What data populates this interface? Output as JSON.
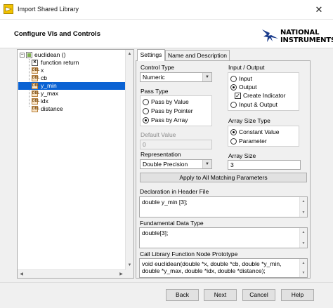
{
  "window": {
    "title": "Import Shared Library",
    "close_glyph": "✕"
  },
  "header": {
    "title": "Configure VIs and Controls",
    "logo_line1": "NATIONAL",
    "logo_line2": "INSTRUMENTS"
  },
  "tree": {
    "root": "euclidean ()",
    "items": [
      {
        "label": "function return",
        "icon": "return-icon"
      },
      {
        "label": "x",
        "icon": "param-icon"
      },
      {
        "label": "cb",
        "icon": "param-icon"
      },
      {
        "label": "y_min",
        "icon": "param-icon",
        "selected": true
      },
      {
        "label": "y_max",
        "icon": "param-icon"
      },
      {
        "label": "idx",
        "icon": "param-icon"
      },
      {
        "label": "distance",
        "icon": "param-icon"
      }
    ]
  },
  "tabs": [
    {
      "label": "Settings",
      "active": true
    },
    {
      "label": "Name and Description",
      "active": false
    }
  ],
  "settings": {
    "control_type_label": "Control Type",
    "control_type_value": "Numeric",
    "pass_type_label": "Pass Type",
    "pass_type_options": [
      "Pass by Value",
      "Pass by Pointer",
      "Pass by Array"
    ],
    "pass_type_selected": "Pass by Array",
    "default_value_label": "Default Value",
    "default_value": "0",
    "representation_label": "Representation",
    "representation_value": "Double Precision",
    "io_label": "Input / Output",
    "io_input": "Input",
    "io_output": "Output",
    "io_create_indicator": "Create Indicator",
    "io_input_output": "Input & Output",
    "array_size_type_label": "Array Size Type",
    "array_size_constant": "Constant Value",
    "array_size_parameter": "Parameter",
    "array_size_label": "Array Size",
    "array_size_value": "3",
    "apply_button": "Apply to All Matching Parameters",
    "declaration_label": "Declaration in Header File",
    "declaration_text": "double  y_min [3];",
    "fundamental_label": "Fundamental Data Type",
    "fundamental_text": "double[3];",
    "prototype_label": "Call Library Function Node Prototype",
    "prototype_text": "void  euclidean(double *x, double *cb, double *y_min, double *y_max, double *idx, double *distance);"
  },
  "footer": {
    "back": "Back",
    "next": "Next",
    "cancel": "Cancel",
    "help": "Help"
  }
}
